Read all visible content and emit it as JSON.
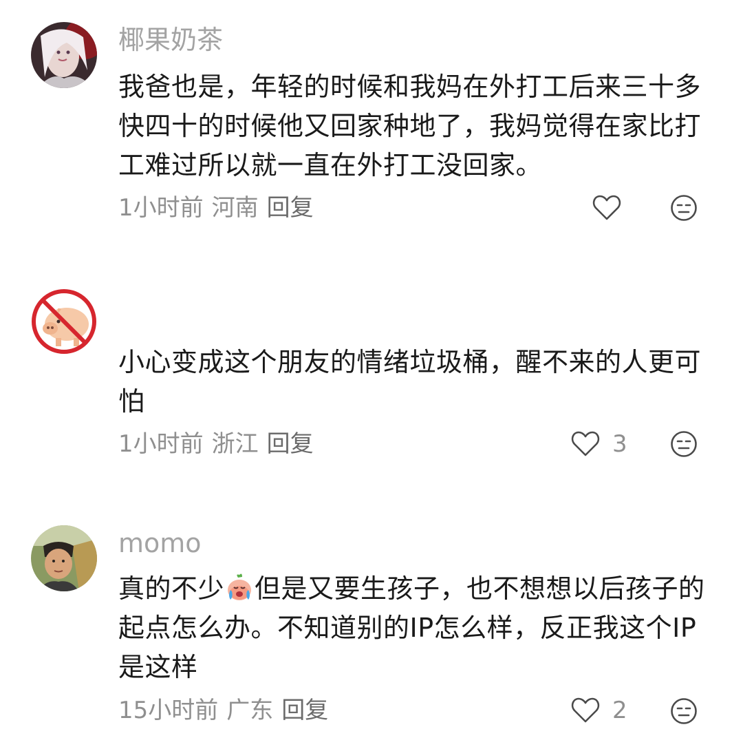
{
  "comments": [
    {
      "username": "椰果奶茶",
      "content": "我爸也是，年轻的时候和我妈在外打工后来三十多快四十的时候他又回家种地了，我妈觉得在家比打工难过所以就一直在外打工没回家。",
      "time": "1小时前",
      "location": "河南",
      "reply_label": "回复",
      "like_count": ""
    },
    {
      "username": "",
      "content": "小心变成这个朋友的情绪垃圾桶，醒不来的人更可怕",
      "time": "1小时前",
      "location": "浙江",
      "reply_label": "回复",
      "like_count": "3"
    },
    {
      "username": "momo",
      "content_before_emoji": "真的不少",
      "content_after_emoji": "但是又要生孩子，也不想想以后孩子的起点怎么办。不知道别的IP怎么样，反正我这个IP是这样",
      "time": "15小时前",
      "location": "广东",
      "reply_label": "回复",
      "like_count": "2"
    }
  ],
  "icons": {
    "like": "heart-outline-icon",
    "dislike": "neutral-face-icon",
    "emoji": "crying-peach-emoji"
  }
}
